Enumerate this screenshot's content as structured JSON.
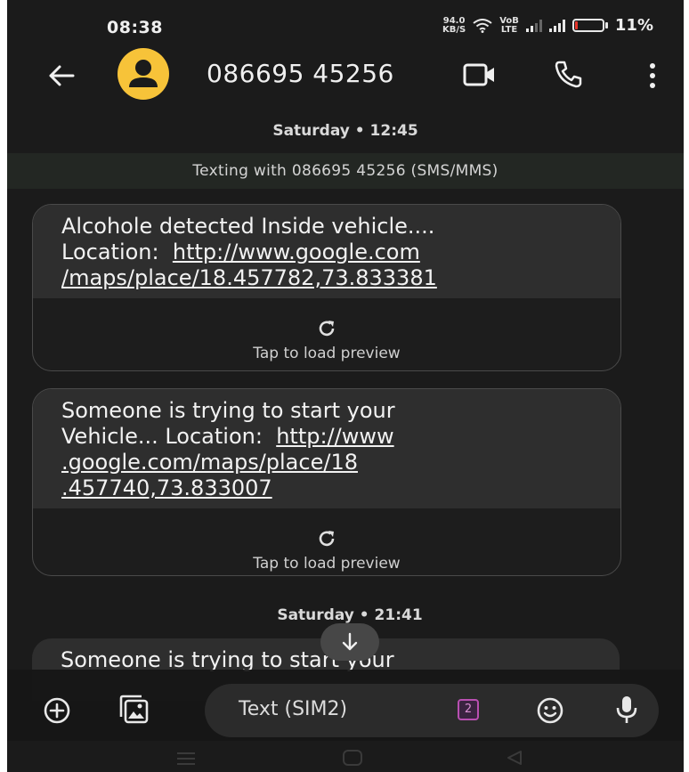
{
  "status_bar": {
    "time": "08:38",
    "net_speed_value": "94.0",
    "net_speed_unit": "KB/S",
    "network_label_top": "VoB",
    "network_label_bottom": "LTE",
    "battery_percent": "11%",
    "battery_level": 0.11,
    "battery_color": "#e5352b"
  },
  "header": {
    "contact_name": "086695 45256",
    "avatar_color": "#f7c339"
  },
  "conversation": {
    "date_1": "Saturday • 12:45",
    "texting_banner": "Texting with 086695 45256 (SMS/MMS)",
    "messages": [
      {
        "line_1": "Alcohole detected Inside vehicle....",
        "line_2_prefix": "Location:  ",
        "link_1": "http://www.google.com",
        "link_2": "/maps/place/18.457782,73.833381",
        "preview_label": "Tap to load preview"
      },
      {
        "line_1": "Someone is trying to start your",
        "line_2_prefix": "Vehicle... Location:  ",
        "link_1": "http://www",
        "link_2": ".google.com/maps/place/18",
        "link_3": ".457740,73.833007",
        "preview_label": "Tap to load preview"
      }
    ],
    "date_2": "Saturday • 21:41",
    "message_3_text": "Someone is trying to start your"
  },
  "compose": {
    "placeholder": "Text (SIM2)",
    "sim_number": "2",
    "sim_color": "#b84fb1"
  },
  "icons": [
    "back-arrow-icon",
    "avatar-person-icon",
    "video-call-icon",
    "phone-icon",
    "more-vert-icon",
    "refresh-icon",
    "arrow-down-icon",
    "add-icon",
    "gallery-icon",
    "emoji-icon",
    "mic-icon",
    "nav-menu-icon",
    "nav-home-icon",
    "nav-back-icon"
  ]
}
